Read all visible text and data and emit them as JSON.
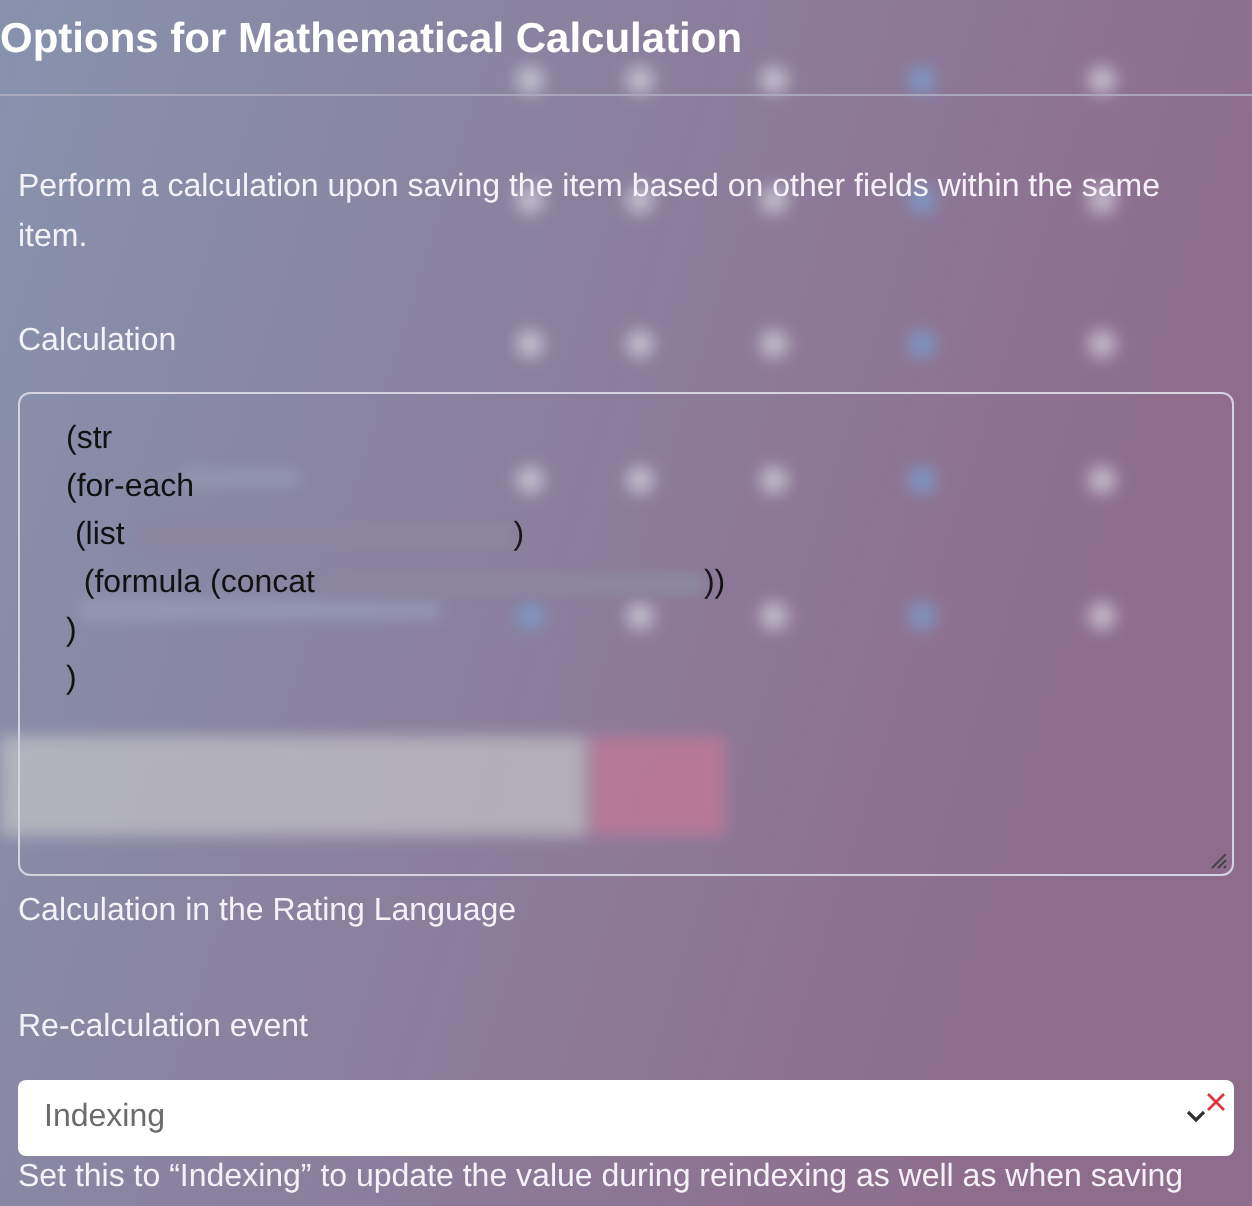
{
  "title": "Options for Mathematical Calculation",
  "description": "Perform a calculation upon saving the item based on other fields within the same item.",
  "calculation": {
    "label": "Calculation",
    "lines": [
      {
        "text": "(str"
      },
      {
        "text": "(for-each"
      },
      {
        "text": " (list ",
        "redacted": true,
        "after": ")"
      },
      {
        "text": "  (formula (concat ",
        "redacted": true,
        "after": "))"
      },
      {
        "text": ")"
      },
      {
        "text": ")"
      }
    ],
    "help": "Calculation in the Rating Language"
  },
  "event": {
    "label": "Re-calculation event",
    "value": "Indexing",
    "invalid": true,
    "help": "Set this to “Indexing” to update the value during reindexing as well as when saving"
  }
}
